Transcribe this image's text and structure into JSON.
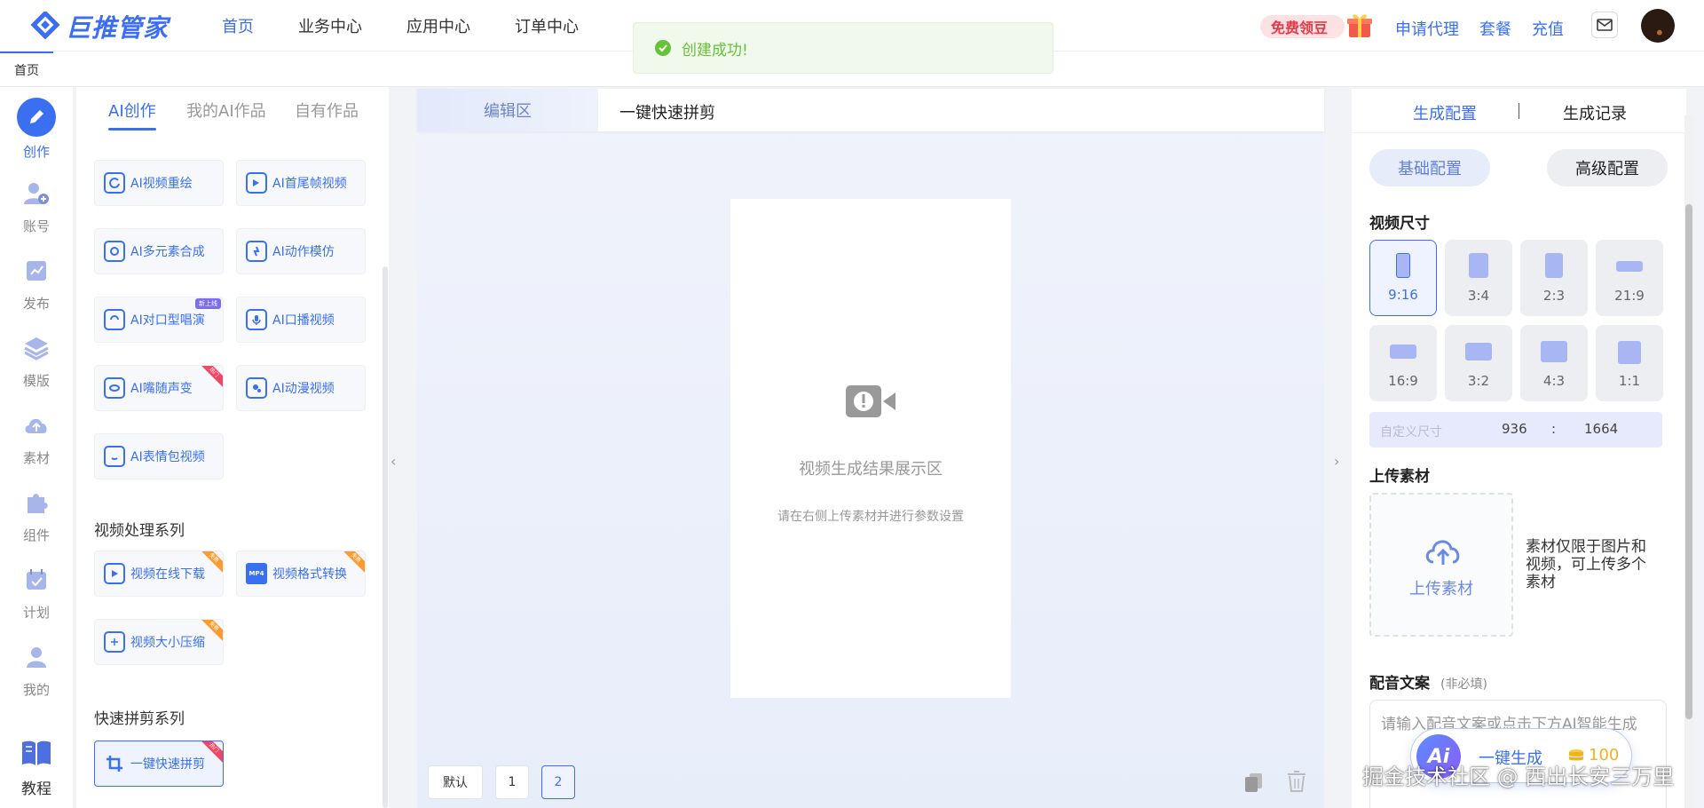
{
  "header": {
    "logo_text": "巨推管家",
    "nav": [
      {
        "label": "首页",
        "active": true
      },
      {
        "label": "业务中心",
        "active": false
      },
      {
        "label": "应用中心",
        "active": false
      },
      {
        "label": "订单中心",
        "active": false
      }
    ],
    "free_beans": "免费领豆",
    "links": [
      "申请代理",
      "套餐",
      "充值"
    ],
    "mail_icon": "mail-icon",
    "avatar_icon": "user-avatar"
  },
  "tabstrip": {
    "home": "首页"
  },
  "iconbar": [
    {
      "label": "创作",
      "icon": "pen-icon",
      "active": true
    },
    {
      "label": "账号",
      "icon": "user-add-icon"
    },
    {
      "label": "发布",
      "icon": "publish-icon"
    },
    {
      "label": "模版",
      "icon": "layers-icon"
    },
    {
      "label": "素材",
      "icon": "cloud-upload-icon"
    },
    {
      "label": "组件",
      "icon": "puzzle-icon"
    },
    {
      "label": "计划",
      "icon": "calendar-check-icon"
    },
    {
      "label": "我的",
      "icon": "person-icon"
    },
    {
      "label": "教程",
      "icon": "book-icon"
    }
  ],
  "toolpanel": {
    "tabs": [
      "AI创作",
      "我的AI作品",
      "自有作品"
    ],
    "active_tab": 0,
    "ai_tools": [
      {
        "label": "AI视频重绘",
        "icon": "refresh-video-icon"
      },
      {
        "label": "AI首尾帧视频",
        "icon": "frame-video-icon"
      },
      {
        "label": "AI多元素合成",
        "icon": "compose-icon"
      },
      {
        "label": "AI动作模仿",
        "icon": "motion-icon"
      },
      {
        "label": "AI对口型唱演",
        "icon": "lipsync-icon",
        "pill": "新上线"
      },
      {
        "label": "AI口播视频",
        "icon": "mic-icon"
      },
      {
        "label": "AI嘴随声变",
        "icon": "mouth-icon",
        "corner": "热门"
      },
      {
        "label": "AI动漫视频",
        "icon": "anime-icon"
      },
      {
        "label": "AI表情包视频",
        "icon": "emoji-icon"
      }
    ],
    "section_video": "视频处理系列",
    "video_tools": [
      {
        "label": "视频在线下载",
        "icon": "play-download-icon",
        "corner": "免费"
      },
      {
        "label": "视频格式转换",
        "icon": "mp4-icon",
        "corner": "免费"
      },
      {
        "label": "视频大小压缩",
        "icon": "compress-icon",
        "corner": "免费"
      }
    ],
    "section_quick": "快速拼剪系列",
    "quick_tools": [
      {
        "label": "一键快速拼剪",
        "icon": "crop-icon",
        "corner": "热门",
        "selected": true
      }
    ]
  },
  "center": {
    "tab_edit": "编辑区",
    "tab_quick": "一键快速拼剪",
    "preview_title": "视频生成结果展示区",
    "preview_sub": "请在右侧上传素材并进行参数设置",
    "pager": [
      "默认",
      "1",
      "2"
    ],
    "active_page": "2",
    "copy_icon": "copy-icon",
    "trash_icon": "trash-icon"
  },
  "rpanel": {
    "tabs": [
      "生成配置",
      "生成记录"
    ],
    "cfg_basic": "基础配置",
    "cfg_advanced": "高级配置",
    "size_title": "视频尺寸",
    "sizes": [
      "9:16",
      "3:4",
      "2:3",
      "21:9",
      "16:9",
      "3:2",
      "4:3",
      "1:1"
    ],
    "selected_size": "9:16",
    "custom_label": "自定义尺寸",
    "custom_w": "936",
    "custom_sep": ":",
    "custom_h": "1664",
    "upload_title": "上传素材",
    "upload_btn": "上传素材",
    "upload_note": "素材仅限于图片和视频，可上传多个素材",
    "voice_title": "配音文案",
    "voice_optional": "(非必填)",
    "voice_placeholder": "请输入配音文案或点击下方AI智能生成",
    "generate": "一键生成",
    "generate_cost": "100",
    "ai_badge": "Ai"
  },
  "toast": {
    "text": "创建成功!"
  },
  "watermark": "掘金技术社区 @ 西出长安三万里",
  "colors": {
    "accent": "#3a6ff2",
    "success": "#67c23a",
    "hot": "#f04864",
    "free": "#ff9a2e"
  }
}
